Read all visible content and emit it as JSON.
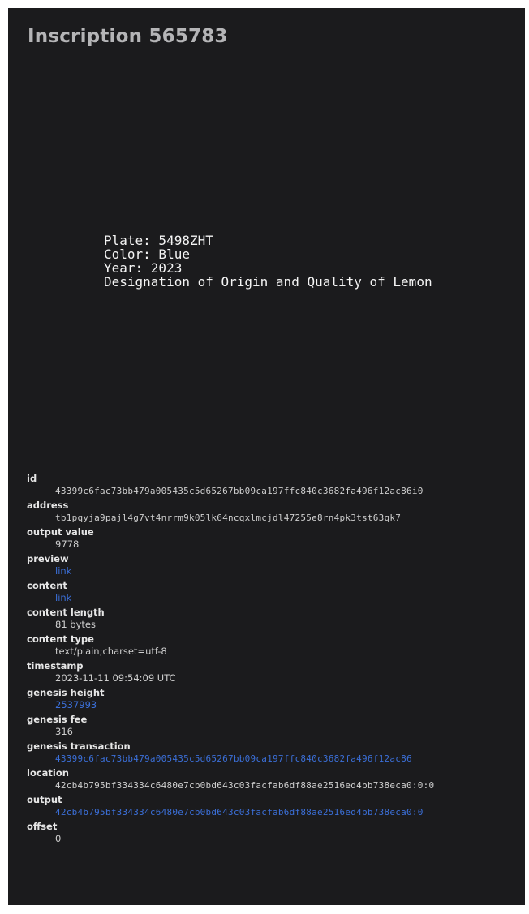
{
  "title": "Inscription 565783",
  "preview_lines": [
    "Plate: 5498ZHT",
    "Color: Blue",
    "Year: 2023",
    "Designation of Origin and Quality of Lemon"
  ],
  "details": {
    "id": {
      "label": "id",
      "value": "43399c6fac73bb479a005435c5d65267bb09ca197ffc840c3682fa496f12ac86i0"
    },
    "address": {
      "label": "address",
      "value": "tb1pqyja9pajl4g7vt4nrrm9k05lk64ncqxlmcjdl47255e8rn4pk3tst63qk7"
    },
    "output_value": {
      "label": "output value",
      "value": "9778"
    },
    "preview": {
      "label": "preview",
      "value": "link"
    },
    "content": {
      "label": "content",
      "value": "link"
    },
    "content_length": {
      "label": "content length",
      "value": "81 bytes"
    },
    "content_type": {
      "label": "content type",
      "value": "text/plain;charset=utf-8"
    },
    "timestamp": {
      "label": "timestamp",
      "value": "2023-11-11 09:54:09 UTC"
    },
    "genesis_height": {
      "label": "genesis height",
      "value": "2537993"
    },
    "genesis_fee": {
      "label": "genesis fee",
      "value": "316"
    },
    "genesis_transaction": {
      "label": "genesis transaction",
      "value": "43399c6fac73bb479a005435c5d65267bb09ca197ffc840c3682fa496f12ac86"
    },
    "location": {
      "label": "location",
      "value": "42cb4b795bf334334c6480e7cb0bd643c03facfab6df88ae2516ed4bb738eca0:0:0"
    },
    "output": {
      "label": "output",
      "value": "42cb4b795bf334334c6480e7cb0bd643c03facfab6df88ae2516ed4bb738eca0:0"
    },
    "offset": {
      "label": "offset",
      "value": "0"
    }
  },
  "colors": {
    "background": "#1b1b1d",
    "link": "#3b6fd8",
    "title": "#b5b5b7"
  }
}
